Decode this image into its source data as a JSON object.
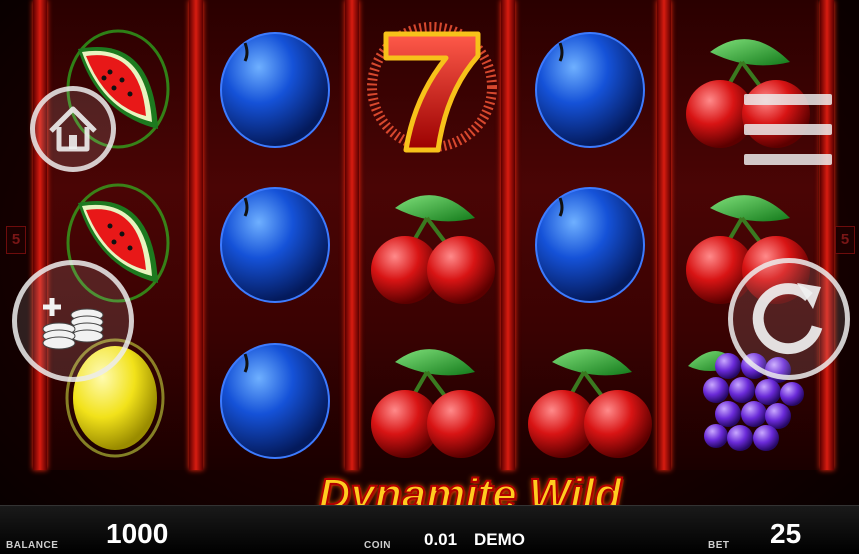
{
  "game": {
    "title": "Dynamite Wild"
  },
  "lines_indicator": {
    "left": "5",
    "right": "5"
  },
  "reels": [
    [
      "watermelon",
      "watermelon",
      "lemon"
    ],
    [
      "plum",
      "plum",
      "plum"
    ],
    [
      "seven",
      "cherry",
      "cherry"
    ],
    [
      "plum",
      "plum",
      "cherry"
    ],
    [
      "cherry",
      "cherry",
      "grapes"
    ]
  ],
  "footer": {
    "balance_label": "BALANCE",
    "balance_value": "1000",
    "coin_label": "COIN",
    "coin_value": "0.01",
    "mode": "DEMO",
    "bet_label": "BET",
    "bet_value": "25"
  },
  "controls": {
    "home": "home-icon",
    "coins": "coins-plus-icon",
    "menu": "menu-icon",
    "spin": "refresh-icon"
  },
  "colors": {
    "frame_red": "#d81c10",
    "title_yellow": "#ffcc20",
    "title_outline": "#b00000"
  }
}
